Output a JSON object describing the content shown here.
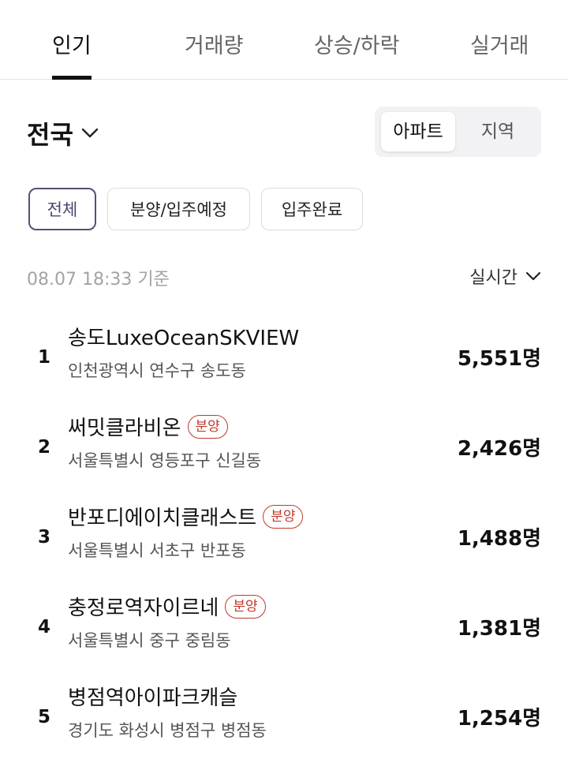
{
  "tabs": [
    {
      "label": "인기",
      "active": true
    },
    {
      "label": "거래량",
      "active": false
    },
    {
      "label": "상승/하락",
      "active": false
    },
    {
      "label": "실거래",
      "active": false
    }
  ],
  "region": {
    "label": "전국",
    "icon": "chevron-down-icon"
  },
  "segment": {
    "apartment": "아파트",
    "area": "지역",
    "selected": "아파트"
  },
  "filters": [
    {
      "label": "전체",
      "active": true
    },
    {
      "label": "분양/입주예정",
      "active": false
    },
    {
      "label": "입주완료",
      "active": false
    }
  ],
  "timestamp": "08.07 18:33 기준",
  "sort": {
    "label": "실시간",
    "icon": "chevron-down-icon"
  },
  "ranking": [
    {
      "rank": "1",
      "name": "송도LuxeOceanSKVIEW",
      "badge": "",
      "address": "인천광역시 연수구 송도동",
      "count": "5,551명"
    },
    {
      "rank": "2",
      "name": "써밋클라비온",
      "badge": "분양",
      "address": "서울특별시 영등포구 신길동",
      "count": "2,426명"
    },
    {
      "rank": "3",
      "name": "반포디에이치클래스트",
      "badge": "분양",
      "address": "서울특별시 서초구 반포동",
      "count": "1,488명"
    },
    {
      "rank": "4",
      "name": "충정로역자이르네",
      "badge": "분양",
      "address": "서울특별시 중구 중림동",
      "count": "1,381명"
    },
    {
      "rank": "5",
      "name": "병점역아이파크캐슬",
      "badge": "",
      "address": "경기도 화성시 병점구 병점동",
      "count": "1,254명"
    }
  ],
  "colors": {
    "accent_border": "#55507a",
    "badge_red": "#c0392b",
    "muted_text": "#a3a3a3"
  }
}
